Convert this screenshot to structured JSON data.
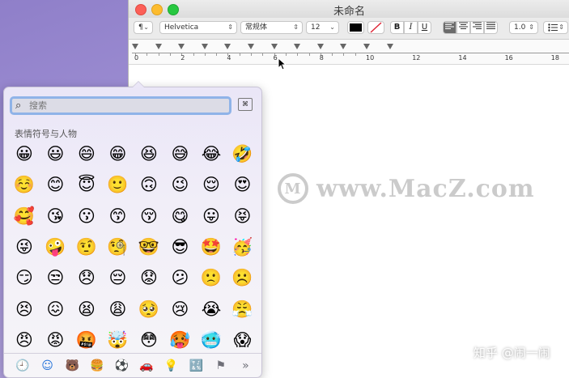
{
  "window": {
    "title": "未命名",
    "toolbar": {
      "paragraph_style": "¶",
      "font_family": "Helvetica",
      "font_style": "常规体",
      "font_size": "12",
      "bold": "B",
      "italic": "I",
      "underline": "U",
      "line_spacing": "1.0",
      "list_icon": "list-icon"
    },
    "ruler": {
      "numbers": [
        "0",
        "2",
        "4",
        "6",
        "8",
        "10",
        "12",
        "14",
        "16",
        "18"
      ]
    }
  },
  "emoji_picker": {
    "search_placeholder": "搜索",
    "section_title": "表情符号与人物",
    "emojis": [
      "😀",
      "😃",
      "😄",
      "😁",
      "😆",
      "😅",
      "😂",
      "🤣",
      "☺️",
      "😊",
      "😇",
      "🙂",
      "🙃",
      "😉",
      "😌",
      "😍",
      "🥰",
      "😘",
      "😗",
      "😙",
      "😚",
      "😋",
      "😛",
      "😝",
      "😜",
      "🤪",
      "🤨",
      "🧐",
      "🤓",
      "😎",
      "🤩",
      "🥳",
      "😏",
      "😒",
      "😞",
      "😔",
      "😟",
      "😕",
      "🙁",
      "☹️",
      "😣",
      "😖",
      "😫",
      "😩",
      "🥺",
      "😢",
      "😭",
      "😤",
      "😠",
      "😡",
      "🤬",
      "🤯",
      "😳",
      "🥵",
      "🥶",
      "😱"
    ],
    "categories": [
      {
        "icon": "clock-icon",
        "glyph": "🕘"
      },
      {
        "icon": "smiley-icon",
        "glyph": "☺"
      },
      {
        "icon": "bear-icon",
        "glyph": "🐻"
      },
      {
        "icon": "food-icon",
        "glyph": "🍔"
      },
      {
        "icon": "ball-icon",
        "glyph": "⚽"
      },
      {
        "icon": "car-icon",
        "glyph": "🚗"
      },
      {
        "icon": "bulb-icon",
        "glyph": "💡"
      },
      {
        "icon": "symbols-icon",
        "glyph": "🔣"
      },
      {
        "icon": "flag-icon",
        "glyph": "⚑"
      },
      {
        "icon": "more-icon",
        "glyph": "»"
      }
    ]
  },
  "watermark": {
    "text": "www.MacZ.com"
  },
  "credit": {
    "text": "知乎 @闹一闹"
  }
}
